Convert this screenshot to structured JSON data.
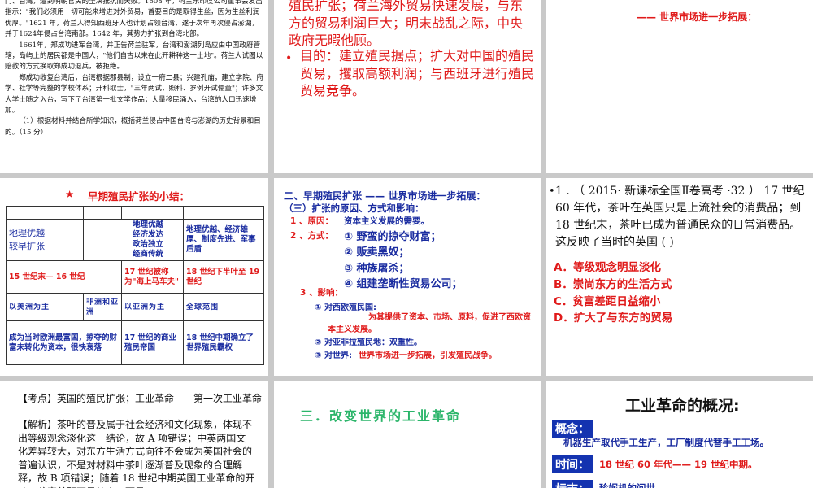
{
  "slide1": {
    "paragraphs": [
      "门、台湾，遭到明朝官民的坚决抵抗而失败。1608 年，荷兰东印度公司董事会发出指示：\"我们必须用一切可能来增进对外贸易，首要目的是取得生丝，因为生丝利润优厚。\"1621 年，荷兰人得知西班牙人也计划占领台湾，遂于次年再次侵占澎湖，并于1624年侵占台湾南部。1642 年，其势力扩张到台湾北部。",
      "1661年，郑成功进军台湾，并正告荷兰驻军，台湾和澎湖列岛应由中国政府管辖，岛屿上的居民都是中国人，\"他们自古以来在此开耕种这一土地\"。荷兰人试图以赔款的方式换取郑成功退兵，被拒绝。",
      "郑成功收复台湾后，台湾根据郡县制，设立一府二县；兴建孔庙，建立学院、府学、社学等完整的学校体系；开科取士，\"三年两试，照科、岁例开试儒童\"；许多文人学士随之入台，写下了台湾第一批文学作品；大量移民涌入，台湾的人口迅速增加。",
      "（1）根据材料并结合所学知识，概括荷兰侵占中国台湾与澎湖的历史背景和目的。（15 分）"
    ]
  },
  "slide2": {
    "text_top": "殖民扩张；荷兰海外贸易快速发展，与东方的贸易利润巨大；明末战乱之际，中央政府无暇他顾。",
    "bullet": "•",
    "text_purpose": "目的：建立殖民据点；扩大对中国的殖民贸易，攫取高额利润；与西班牙进行殖民贸易竞争。"
  },
  "slide3": {
    "subtitle": "—— 世界市场进一步拓展："
  },
  "slide4": {
    "star": "★",
    "title": "早期殖民扩张的小结：",
    "rows": {
      "a": [
        "地理优越\n较早扩张",
        "地理优越\n经济发达\n政治独立\n经商传统",
        "地理优越、经济雄厚、制度先进、军事后盾"
      ],
      "b": [
        "15 世纪末— 16 世纪",
        "17 世纪被称为\"海上马车夫\"",
        "18 世纪下半叶至 19 世纪"
      ],
      "c": [
        "以美洲为主",
        "非洲和亚洲",
        "以亚洲为主",
        "全球范围"
      ],
      "d": [
        "成为当时欧洲最富国，掠夺的财富未转化为资本，很快衰落",
        "17 世纪的商业殖民帝国",
        "18 世纪中期确立了世界殖民霸权"
      ]
    }
  },
  "slide5": {
    "title": "二、早期殖民扩张 —— 世界市场进一步拓展：",
    "sub": "（三）扩张的原因、方式和影响：",
    "reason_label": "1 、原因：",
    "reason": "资本主义发展的需要。",
    "method_label": "2 、方式：",
    "methods": [
      "① 野蛮的掠夺财富；",
      "② 贩卖黑奴；",
      "③ 种族屠杀；",
      "④ 组建垄断性贸易公司；"
    ],
    "impact_label": "3 、影响：",
    "impact1": "① 对西欧殖民国:",
    "impact1_text": "为其提供了资本、市场、原料，促进了西欧资本主义发展。",
    "impact2": "② 对亚非拉殖民地：双重性。",
    "impact3_label": "③ 对世界:",
    "impact3": "世界市场进一步拓展，引发殖民战争。"
  },
  "slide6": {
    "bullet": "•",
    "question": "1 . （ 2015· 新课标全国Ⅱ卷高考 ·32 ） 17 世纪 60 年代，茶叶在英国只是上流社会的消费品；到 18 世纪末，茶叶已成为普通民众的日常消费品。这反映了当时的英国 (        )",
    "options": [
      "A．等级观念明显淡化",
      "B．崇尚东方的生活方式",
      "C．贫富差距日益缩小",
      "D．扩大了与东方的贸易"
    ]
  },
  "slide7": {
    "kaodian": "【考点】英国的殖民扩张；工业革命——第一次工业革命",
    "jiexi": "【解析】茶叶的普及属于社会经济和文化现象，体现不出等级观念淡化这一结论，故 A 项错误；中英两国文化差异较大，对东方生活方式向往不会成为英国社会的普遍认识，不是对材料中茶叶逐渐普及现象的合理解释，故 B 项错误；随着 18 世纪中期英国工业革命的开始，贫富差距不是缩小，而是"
  },
  "slide8": {
    "title": "三．改变世界的工业革命"
  },
  "slide9": {
    "title": "工业革命的概况:",
    "concept_label": "概念：",
    "concept": "机器生产取代手工生产，工厂制度代替手工工场。",
    "time_label": "时间：",
    "time": "18 世纪 60 年代—— 19 世纪中期。",
    "mark_label": "标志：",
    "mark": "珍妮机的问世"
  },
  "colors": {
    "red": "#e01a1a",
    "blue": "#1a2ca0",
    "green": "#2bb56a",
    "box_blue": "#1433b0"
  }
}
